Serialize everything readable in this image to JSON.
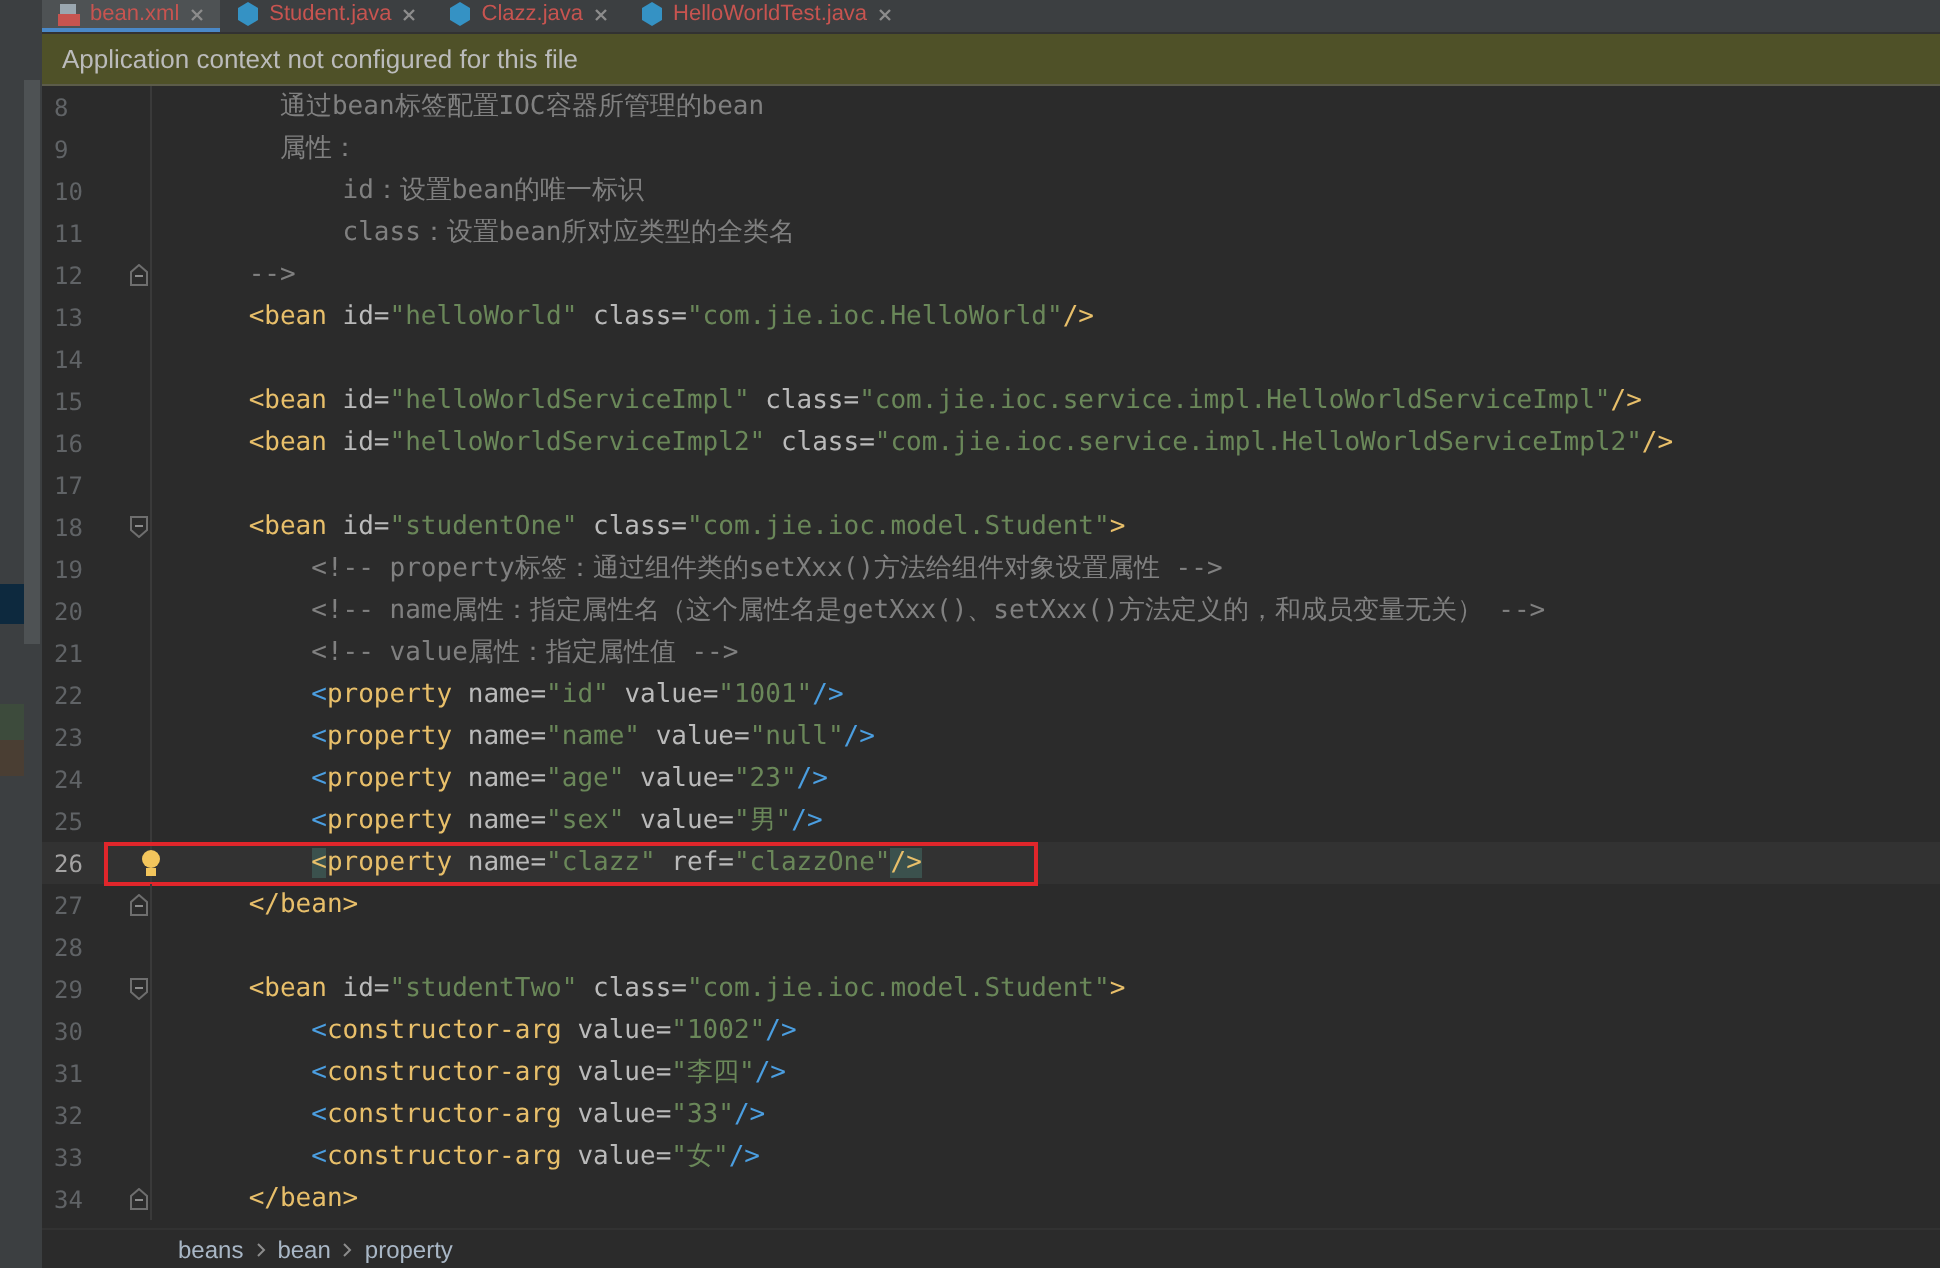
{
  "tabs": [
    {
      "label": "bean.xml",
      "kind": "xml",
      "selected": true
    },
    {
      "label": "Student.java",
      "kind": "class",
      "selected": false
    },
    {
      "label": "Clazz.java",
      "kind": "class",
      "selected": false
    },
    {
      "label": "HelloWorldTest.java",
      "kind": "class",
      "selected": false
    }
  ],
  "banner": {
    "text": "Application context not configured for this file"
  },
  "lines": [
    {
      "number": "8",
      "kind": "plain",
      "current": false,
      "boxed": false,
      "segments": [
        {
          "kind": "comment",
          "text": "      通过bean标签配置IOC容器所管理的bean"
        }
      ]
    },
    {
      "number": "9",
      "kind": "plain",
      "current": false,
      "boxed": false,
      "segments": [
        {
          "kind": "comment",
          "text": "      属性："
        }
      ]
    },
    {
      "number": "10",
      "kind": "plain",
      "current": false,
      "boxed": false,
      "segments": [
        {
          "kind": "comment",
          "text": "          id：设置bean的唯一标识"
        }
      ]
    },
    {
      "number": "11",
      "kind": "plain",
      "current": false,
      "boxed": false,
      "segments": [
        {
          "kind": "comment",
          "text": "          class：设置bean所对应类型的全类名"
        }
      ]
    },
    {
      "number": "12",
      "kind": "fold-end",
      "current": false,
      "boxed": false,
      "segments": [
        {
          "kind": "comment",
          "text": "    -->"
        }
      ]
    },
    {
      "number": "13",
      "kind": "plain",
      "current": false,
      "boxed": false,
      "segments": [
        {
          "kind": "tag",
          "text": "    <bean "
        },
        {
          "kind": "attr",
          "text": "id="
        },
        {
          "kind": "string",
          "text": "\"helloWorld\" "
        },
        {
          "kind": "attr",
          "text": "class="
        },
        {
          "kind": "string",
          "text": "\"com.jie.ioc.HelloWorld\""
        },
        {
          "kind": "tag",
          "text": "/>"
        }
      ]
    },
    {
      "number": "14",
      "kind": "plain",
      "current": false,
      "boxed": false
    },
    {
      "number": "15",
      "kind": "plain",
      "current": false,
      "boxed": false,
      "segments": [
        {
          "kind": "tag",
          "text": "    <bean "
        },
        {
          "kind": "attr",
          "text": "id="
        },
        {
          "kind": "string",
          "text": "\"helloWorldServiceImpl\" "
        },
        {
          "kind": "attr",
          "text": "class="
        },
        {
          "kind": "string",
          "text": "\"com.jie.ioc.service.impl.HelloWorldServiceImpl\""
        },
        {
          "kind": "tag",
          "text": "/>"
        }
      ]
    },
    {
      "number": "16",
      "kind": "plain",
      "current": false,
      "boxed": false,
      "segments": [
        {
          "kind": "tag",
          "text": "    <bean "
        },
        {
          "kind": "attr",
          "text": "id="
        },
        {
          "kind": "string",
          "text": "\"helloWorldServiceImpl2\" "
        },
        {
          "kind": "attr",
          "text": "class="
        },
        {
          "kind": "string",
          "text": "\"com.jie.ioc.service.impl.HelloWorldServiceImpl2\""
        },
        {
          "kind": "tag",
          "text": "/>"
        }
      ]
    },
    {
      "number": "17",
      "kind": "plain",
      "current": false,
      "boxed": false
    },
    {
      "number": "18",
      "kind": "fold-start",
      "current": false,
      "boxed": false,
      "segments": [
        {
          "kind": "tag",
          "text": "    <bean "
        },
        {
          "kind": "attr",
          "text": "id="
        },
        {
          "kind": "string",
          "text": "\"studentOne\" "
        },
        {
          "kind": "attr",
          "text": "class="
        },
        {
          "kind": "string",
          "text": "\"com.jie.ioc.model.Student\""
        },
        {
          "kind": "tag",
          "text": ">"
        }
      ]
    },
    {
      "number": "19",
      "kind": "plain",
      "current": false,
      "boxed": false,
      "segments": [
        {
          "kind": "comment",
          "text": "        <!-- property标签：通过组件类的setXxx()方法给组件对象设置属性 -->"
        }
      ]
    },
    {
      "number": "20",
      "kind": "plain",
      "current": false,
      "boxed": false,
      "segments": [
        {
          "kind": "comment",
          "text": "        <!-- name属性：指定属性名（这个属性名是getXxx()、setXxx()方法定义的，和成员变量无关） -->"
        }
      ]
    },
    {
      "number": "21",
      "kind": "plain",
      "current": false,
      "boxed": false,
      "segments": [
        {
          "kind": "comment",
          "text": "        <!-- value属性：指定属性值 -->"
        }
      ]
    },
    {
      "number": "22",
      "kind": "plain",
      "current": false,
      "boxed": false,
      "segments": [
        {
          "kind": "bracket",
          "text": "        <"
        },
        {
          "kind": "tag",
          "text": "property "
        },
        {
          "kind": "attr",
          "text": "name="
        },
        {
          "kind": "string",
          "text": "\"id\" "
        },
        {
          "kind": "attr",
          "text": "value="
        },
        {
          "kind": "string",
          "text": "\"1001\""
        },
        {
          "kind": "bracket",
          "text": "/>"
        }
      ]
    },
    {
      "number": "23",
      "kind": "plain",
      "current": false,
      "boxed": false,
      "segments": [
        {
          "kind": "bracket",
          "text": "        <"
        },
        {
          "kind": "tag",
          "text": "property "
        },
        {
          "kind": "attr",
          "text": "name="
        },
        {
          "kind": "string",
          "text": "\"name\" "
        },
        {
          "kind": "attr",
          "text": "value="
        },
        {
          "kind": "string",
          "text": "\"null\""
        },
        {
          "kind": "bracket",
          "text": "/>"
        }
      ]
    },
    {
      "number": "24",
      "kind": "plain",
      "current": false,
      "boxed": false,
      "segments": [
        {
          "kind": "bracket",
          "text": "        <"
        },
        {
          "kind": "tag",
          "text": "property "
        },
        {
          "kind": "attr",
          "text": "name="
        },
        {
          "kind": "string",
          "text": "\"age\" "
        },
        {
          "kind": "attr",
          "text": "value="
        },
        {
          "kind": "string",
          "text": "\"23\""
        },
        {
          "kind": "bracket",
          "text": "/>"
        }
      ]
    },
    {
      "number": "25",
      "kind": "plain",
      "current": false,
      "boxed": false,
      "segments": [
        {
          "kind": "bracket",
          "text": "        <"
        },
        {
          "kind": "tag",
          "text": "property "
        },
        {
          "kind": "attr",
          "text": "name="
        },
        {
          "kind": "string",
          "text": "\"sex\" "
        },
        {
          "kind": "attr",
          "text": "value="
        },
        {
          "kind": "string",
          "text": "\"男\""
        },
        {
          "kind": "bracket",
          "text": "/>"
        }
      ]
    },
    {
      "number": "26",
      "kind": "bulb",
      "current": true,
      "boxed": true,
      "segments": [
        {
          "kind": "matched",
          "text": "        <"
        },
        {
          "kind": "tag",
          "text": "property "
        },
        {
          "kind": "attr",
          "text": "name="
        },
        {
          "kind": "string",
          "text": "\"clazz\" "
        },
        {
          "kind": "attr",
          "text": "ref="
        },
        {
          "kind": "string",
          "text": "\"clazzOne\""
        },
        {
          "kind": "matched",
          "text": "/>"
        }
      ]
    },
    {
      "number": "27",
      "kind": "fold-end",
      "current": false,
      "boxed": false,
      "segments": [
        {
          "kind": "tag",
          "text": "    </bean>"
        }
      ]
    },
    {
      "number": "28",
      "kind": "plain",
      "current": false,
      "boxed": false
    },
    {
      "number": "29",
      "kind": "fold-start",
      "current": false,
      "boxed": false,
      "segments": [
        {
          "kind": "tag",
          "text": "    <bean "
        },
        {
          "kind": "attr",
          "text": "id="
        },
        {
          "kind": "string",
          "text": "\"studentTwo\" "
        },
        {
          "kind": "attr",
          "text": "class="
        },
        {
          "kind": "string",
          "text": "\"com.jie.ioc.model.Student\""
        },
        {
          "kind": "tag",
          "text": ">"
        }
      ]
    },
    {
      "number": "30",
      "kind": "plain",
      "current": false,
      "boxed": false,
      "segments": [
        {
          "kind": "bracket",
          "text": "        <"
        },
        {
          "kind": "tag",
          "text": "constructor-arg "
        },
        {
          "kind": "attr",
          "text": "value="
        },
        {
          "kind": "string",
          "text": "\"1002\""
        },
        {
          "kind": "bracket",
          "text": "/>"
        }
      ]
    },
    {
      "number": "31",
      "kind": "plain",
      "current": false,
      "boxed": false,
      "segments": [
        {
          "kind": "bracket",
          "text": "        <"
        },
        {
          "kind": "tag",
          "text": "constructor-arg "
        },
        {
          "kind": "attr",
          "text": "value="
        },
        {
          "kind": "string",
          "text": "\"李四\""
        },
        {
          "kind": "bracket",
          "text": "/>"
        }
      ]
    },
    {
      "number": "32",
      "kind": "plain",
      "current": false,
      "boxed": false,
      "segments": [
        {
          "kind": "bracket",
          "text": "        <"
        },
        {
          "kind": "tag",
          "text": "constructor-arg "
        },
        {
          "kind": "attr",
          "text": "value="
        },
        {
          "kind": "string",
          "text": "\"33\""
        },
        {
          "kind": "bracket",
          "text": "/>"
        }
      ]
    },
    {
      "number": "33",
      "kind": "plain",
      "current": false,
      "boxed": false,
      "segments": [
        {
          "kind": "bracket",
          "text": "        <"
        },
        {
          "kind": "tag",
          "text": "constructor-arg "
        },
        {
          "kind": "attr",
          "text": "value="
        },
        {
          "kind": "string",
          "text": "\"女\""
        },
        {
          "kind": "bracket",
          "text": "/>"
        }
      ]
    },
    {
      "number": "34",
      "kind": "fold-end",
      "current": false,
      "boxed": false,
      "segments": [
        {
          "kind": "tag",
          "text": "    </bean>"
        }
      ]
    }
  ],
  "breadcrumbs": [
    "beans",
    "bean",
    "property"
  ]
}
